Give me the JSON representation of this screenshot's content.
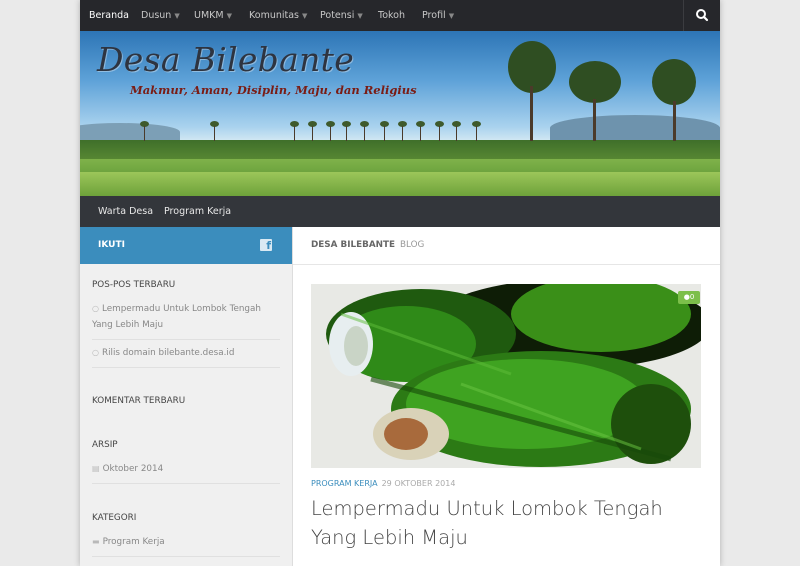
{
  "topnav": {
    "items": [
      {
        "label": "Beranda",
        "dropdown": false
      },
      {
        "label": "Dusun",
        "dropdown": true
      },
      {
        "label": "UMKM",
        "dropdown": true
      },
      {
        "label": "Komunitas",
        "dropdown": true
      },
      {
        "label": "Potensi",
        "dropdown": true
      },
      {
        "label": "Tokoh",
        "dropdown": false
      },
      {
        "label": "Profil",
        "dropdown": true
      }
    ],
    "search_icon": "search-icon"
  },
  "header": {
    "title": "Desa Bilebante",
    "tagline": "Makmur, Aman, Disiplin, Maju, dan Religius"
  },
  "subnav": {
    "items": [
      "Warta Desa",
      "Program Kerja"
    ]
  },
  "sidebar": {
    "follow_label": "IKUTI",
    "follow_icon": "facebook-icon",
    "recent_posts_title": "POS-POS TERBARU",
    "recent_posts": [
      "Lempermadu Untuk Lombok Tengah Yang Lebih Maju",
      "Rilis domain bilebante.desa.id"
    ],
    "recent_comments_title": "KOMENTAR TERBARU",
    "archive_title": "ARSIP",
    "archive_items": [
      "Oktober 2014"
    ],
    "categories_title": "KATEGORI",
    "categories": [
      "Program Kerja"
    ]
  },
  "main": {
    "breadcrumb_site": "DESA BILEBANTE",
    "breadcrumb_page": "BLOG",
    "post": {
      "comment_count": "0",
      "category": "PROGRAM KERJA",
      "date": "29 OKTOBER 2014",
      "title": "Lempermadu Untuk Lombok Tengah Yang Lebih Maju"
    }
  },
  "colors": {
    "topbar": "#26272b",
    "subbar": "#33363b",
    "accent_blue": "#3b8dbd",
    "comment_green": "#7cbf4a"
  }
}
